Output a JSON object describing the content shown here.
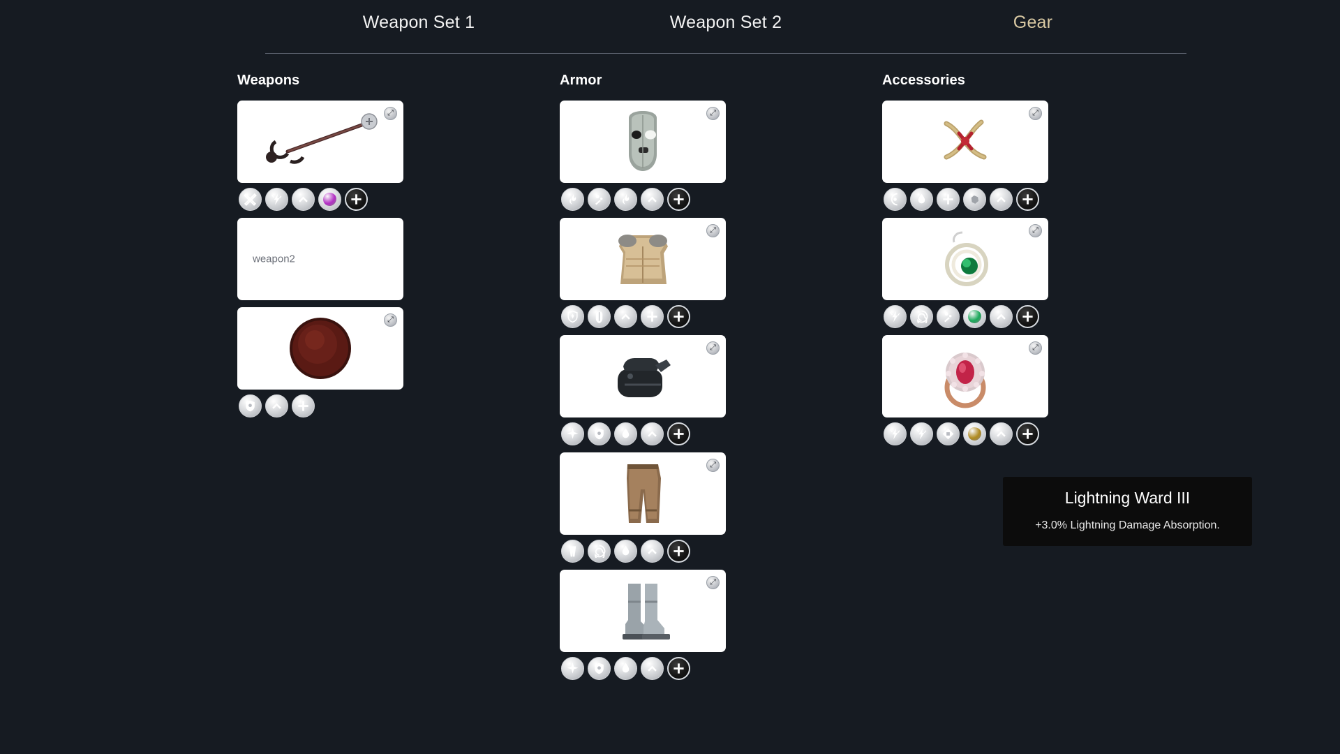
{
  "tabs": [
    {
      "label": "Weapon Set 1",
      "active": false
    },
    {
      "label": "Weapon Set 2",
      "active": false
    },
    {
      "label": "Gear",
      "active": true
    }
  ],
  "colors": {
    "background": "#161b22",
    "active_tab": "#d9c9a3",
    "inactive_tab": "#f2f2f2",
    "card": "#ffffff",
    "tooltip_bg": "#0c0c0c",
    "gem_purple": "#b32ec4",
    "gem_green": "#1aa95a",
    "gem_gold": "#b08a1e"
  },
  "columns": [
    {
      "title": "Weapons",
      "items": [
        {
          "art": "longsword",
          "alt": "",
          "broken_icon": "broken-image-icon",
          "badges": [
            {
              "icon": "cross-swords-icon",
              "style": "stone"
            },
            {
              "icon": "lightning-strike-icon",
              "style": "stone"
            },
            {
              "icon": "chevron-up-icon",
              "style": "stone"
            },
            {
              "icon": "gem-purple-icon",
              "style": "gem",
              "gem": "#b32ec4"
            },
            {
              "icon": "plus-dark-icon",
              "style": "dark"
            }
          ]
        },
        {
          "art": "",
          "alt": "weapon2",
          "broken_icon": "",
          "badges": []
        },
        {
          "art": "round-shield",
          "alt": "",
          "broken_icon": "broken-image-icon",
          "badges": [
            {
              "icon": "shield-icon",
              "style": "stone"
            },
            {
              "icon": "chevron-up-icon",
              "style": "stone"
            },
            {
              "icon": "plus-icon",
              "style": "stone"
            }
          ]
        }
      ]
    },
    {
      "title": "Armor",
      "items": [
        {
          "art": "helmet",
          "alt": "",
          "broken_icon": "broken-image-icon",
          "badges": [
            {
              "icon": "flame-icon",
              "style": "stone"
            },
            {
              "icon": "splash-icon",
              "style": "stone"
            },
            {
              "icon": "flame-icon",
              "style": "stone"
            },
            {
              "icon": "chevron-up-icon",
              "style": "stone"
            },
            {
              "icon": "plus-dark-icon",
              "style": "dark"
            }
          ]
        },
        {
          "art": "chestplate",
          "alt": "",
          "broken_icon": "broken-image-icon",
          "badges": [
            {
              "icon": "crest-icon",
              "style": "stone"
            },
            {
              "icon": "torso-armor-icon",
              "style": "stone"
            },
            {
              "icon": "chevron-up-icon",
              "style": "stone"
            },
            {
              "icon": "plus-icon",
              "style": "stone"
            },
            {
              "icon": "plus-dark-icon",
              "style": "dark"
            }
          ]
        },
        {
          "art": "gauntlet",
          "alt": "",
          "broken_icon": "broken-image-icon",
          "badges": [
            {
              "icon": "sparkle-icon",
              "style": "stone"
            },
            {
              "icon": "shield-icon",
              "style": "stone"
            },
            {
              "icon": "droplet-icon",
              "style": "stone"
            },
            {
              "icon": "chevron-up-icon",
              "style": "stone"
            },
            {
              "icon": "plus-dark-icon",
              "style": "dark"
            }
          ]
        },
        {
          "art": "trousers",
          "alt": "",
          "broken_icon": "broken-image-icon",
          "badges": [
            {
              "icon": "legs-armor-icon",
              "style": "stone"
            },
            {
              "icon": "swirl-icon",
              "style": "stone"
            },
            {
              "icon": "droplet-icon",
              "style": "stone"
            },
            {
              "icon": "chevron-up-icon",
              "style": "stone"
            },
            {
              "icon": "plus-dark-icon",
              "style": "dark"
            }
          ]
        },
        {
          "art": "boots",
          "alt": "",
          "broken_icon": "broken-image-icon",
          "badges": [
            {
              "icon": "sparkle-icon",
              "style": "stone"
            },
            {
              "icon": "shield-icon",
              "style": "stone"
            },
            {
              "icon": "droplet-icon",
              "style": "stone"
            },
            {
              "icon": "chevron-up-icon",
              "style": "stone"
            },
            {
              "icon": "plus-dark-icon",
              "style": "dark"
            }
          ]
        }
      ]
    },
    {
      "title": "Accessories",
      "items": [
        {
          "art": "amulet",
          "alt": "",
          "broken_icon": "broken-image-icon",
          "badges": [
            {
              "icon": "moon-icon",
              "style": "stone"
            },
            {
              "icon": "droplet-icon",
              "style": "stone"
            },
            {
              "icon": "plus-icon",
              "style": "stone"
            },
            {
              "icon": "stone-icon",
              "style": "stone"
            },
            {
              "icon": "chevron-up-icon",
              "style": "stone"
            },
            {
              "icon": "plus-dark-icon",
              "style": "dark"
            }
          ]
        },
        {
          "art": "earring",
          "alt": "",
          "broken_icon": "broken-image-icon",
          "badges": [
            {
              "icon": "lightning-strike-icon",
              "style": "stone"
            },
            {
              "icon": "swirl-icon",
              "style": "stone"
            },
            {
              "icon": "splash-icon",
              "style": "stone"
            },
            {
              "icon": "gem-green-icon",
              "style": "gem",
              "gem": "#1aa95a"
            },
            {
              "icon": "chevron-up-icon",
              "style": "stone"
            },
            {
              "icon": "plus-dark-icon",
              "style": "dark"
            }
          ]
        },
        {
          "art": "ring",
          "alt": "",
          "broken_icon": "broken-image-icon",
          "badges": [
            {
              "icon": "lightning-strike-icon",
              "style": "stone"
            },
            {
              "icon": "lightning-strike-icon",
              "style": "stone"
            },
            {
              "icon": "square-rune-icon",
              "style": "stone"
            },
            {
              "icon": "gem-gold-icon",
              "style": "gem",
              "gem": "#b08a1e"
            },
            {
              "icon": "chevron-up-icon",
              "style": "stone"
            },
            {
              "icon": "plus-dark-icon",
              "style": "dark"
            }
          ]
        }
      ]
    }
  ],
  "tooltip": {
    "title": "Lightning Ward III",
    "description": "+3.0% Lightning Damage Absorption."
  }
}
